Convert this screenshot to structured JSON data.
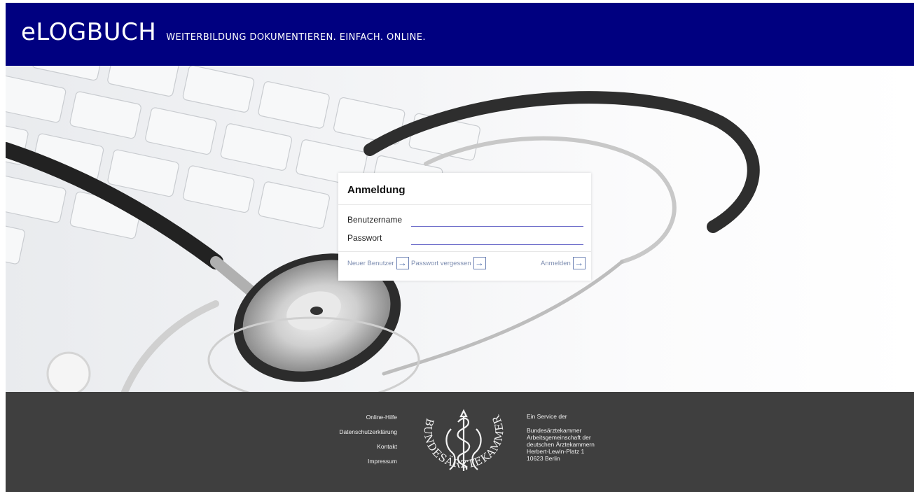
{
  "header": {
    "logo": "eLOGBUCH",
    "tagline": "WEITERBILDUNG DOKUMENTIEREN. EINFACH. ONLINE."
  },
  "login": {
    "title": "Anmeldung",
    "username_label": "Benutzername",
    "username_value": "",
    "password_label": "Passwort",
    "password_value": "",
    "new_user_label": "Neuer Benutzer",
    "forgot_password_label": "Passwort vergessen",
    "login_label": "Anmelden",
    "arrow": "→"
  },
  "footer": {
    "links": [
      "Online-Hilfe",
      "Datenschutzerklärung",
      "Kontakt",
      "Impressum"
    ],
    "seal_text": "BUNDESÄRZTEKAMMER",
    "service_heading": "Ein Service der",
    "service_lines": [
      "Bundesärztekammer",
      "Arbeitsgemeinschaft der",
      "deutschen Ärztekammern",
      "Herbert-Lewin-Platz 1",
      "10623 Berlin"
    ]
  },
  "colors": {
    "header_bg": "#000080",
    "footer_bg": "#3f3f3f",
    "input_underline": "#6b6bc9",
    "link_text": "#7d8db0"
  },
  "icons": [
    "arrow-right-icon",
    "stethoscope-image",
    "keyboard-image",
    "bundesaerztekammer-seal"
  ]
}
